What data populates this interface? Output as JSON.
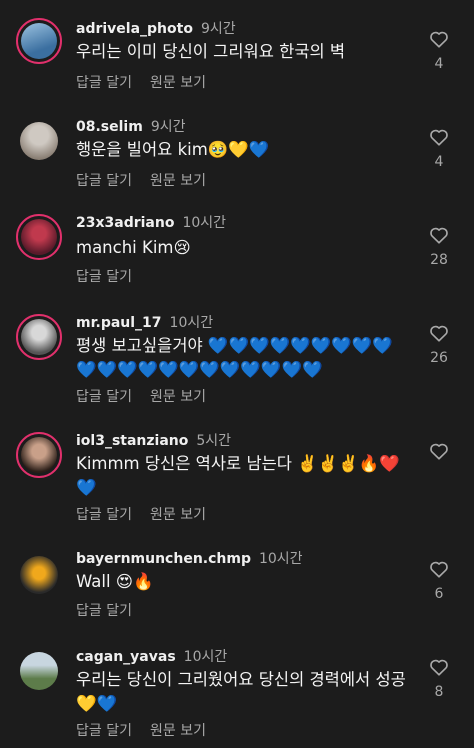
{
  "comments": [
    {
      "username": "adrivela_photo",
      "time": "9시간",
      "text": "우리는 이미 당신이 그리워요 한국의 벽",
      "reply": "답글 달기",
      "translate": "원문 보기",
      "likes": "4",
      "avatar_colors": [
        "#3b6fa0",
        "#9cc3e0"
      ]
    },
    {
      "username": "08.selim",
      "time": "9시간",
      "text": "행운을 빌어요 kim🥹💛💙",
      "reply": "답글 달기",
      "translate": "원문 보기",
      "likes": "4",
      "avatar_colors": [
        "#cfc9c2",
        "#8a7f74"
      ]
    },
    {
      "username": "23x3adriano",
      "time": "10시간",
      "text": "manchi Kim😢",
      "reply": "답글 달기",
      "likes": "28",
      "avatar_colors": [
        "#5a1a2a",
        "#c0394d"
      ]
    },
    {
      "username": "mr.paul_17",
      "time": "10시간",
      "text": "평생 보고싶을거야 💙💙💙💙💙💙💙💙💙💙💙💙💙💙💙💙💙💙💙💙💙",
      "reply": "답글 달기",
      "translate": "원문 보기",
      "likes": "26",
      "avatar_colors": [
        "#d8d8d8",
        "#555555"
      ]
    },
    {
      "username": "iol3_stanziano",
      "time": "5시간",
      "text": "Kimmm 당신은 역사로 남는다 ✌️✌️✌️🔥❤️💙",
      "reply": "답글 달기",
      "translate": "원문 보기",
      "likes": "",
      "avatar_colors": [
        "#c9a089",
        "#2b1e18"
      ]
    },
    {
      "username": "bayernmunchen.chmp",
      "time": "10시간",
      "text": "Wall 😍🔥",
      "reply": "답글 달기",
      "likes": "6",
      "avatar_colors": [
        "#f0a81c",
        "#2a2a2a"
      ]
    },
    {
      "username": "cagan_yavas",
      "time": "10시간",
      "text": "우리는 당신이 그리웠어요 당신의 경력에서 성공 💛💙",
      "reply": "답글 달기",
      "translate": "원문 보기",
      "likes": "8",
      "avatar_colors": [
        "#5d7c4a",
        "#c8d6e0"
      ]
    }
  ],
  "colors": {
    "background": "#1c1c1c",
    "story_ring": "#e1306c",
    "secondary_text": "#a8a8a8"
  }
}
